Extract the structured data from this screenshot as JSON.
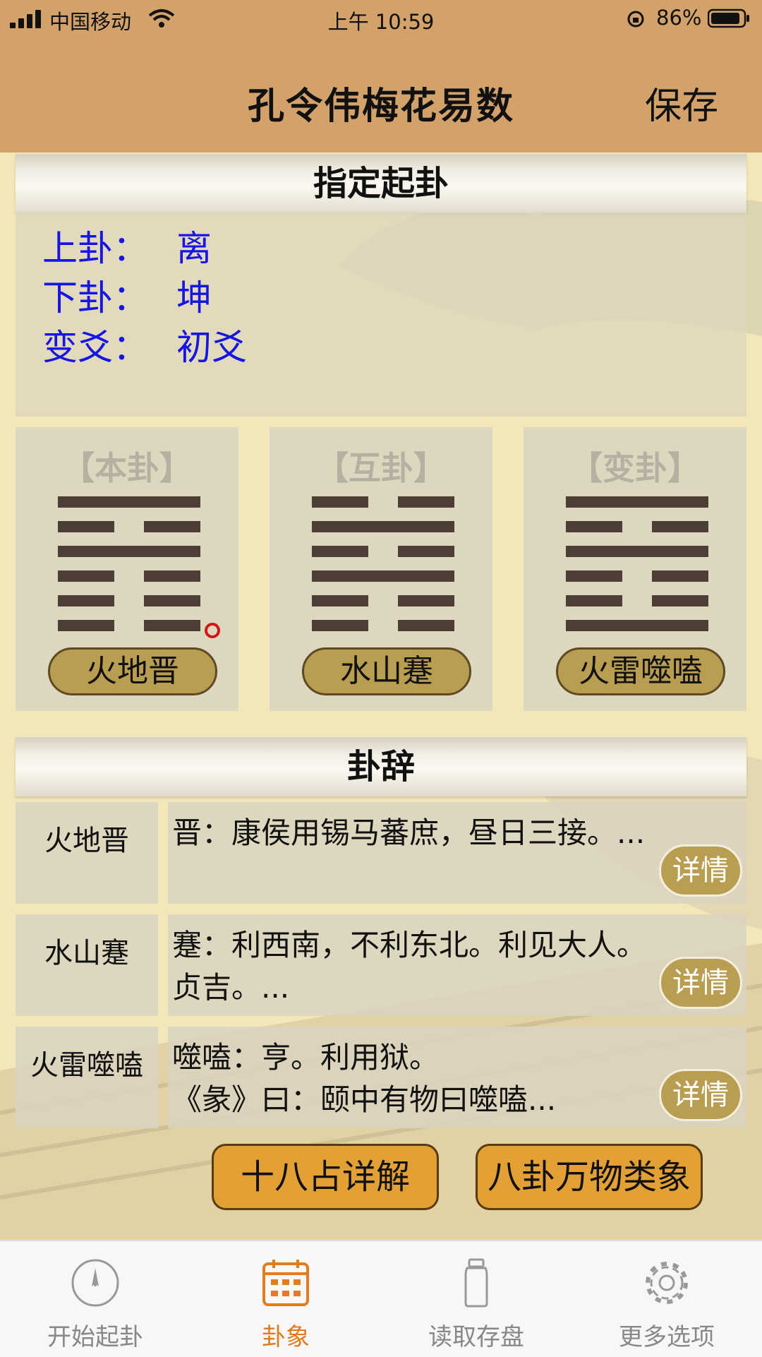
{
  "status_bar": {
    "carrier": "中国移动",
    "time": "上午 10:59",
    "battery": "86%"
  },
  "nav": {
    "title": "孔令伟梅花易数",
    "save_label": "保存"
  },
  "designation": {
    "header": "指定起卦",
    "rows": [
      {
        "label": "上卦：",
        "value": "离"
      },
      {
        "label": "下卦：",
        "value": "坤"
      },
      {
        "label": "变爻：",
        "value": "初爻"
      }
    ]
  },
  "hexagrams": [
    {
      "title": "【本卦】",
      "name": "火地晋",
      "lines_top_to_bottom": [
        "yang",
        "yin",
        "yang",
        "yin",
        "yin",
        "yin"
      ],
      "moving_line": 6
    },
    {
      "title": "【互卦】",
      "name": "水山蹇",
      "lines_top_to_bottom": [
        "yin",
        "yang",
        "yin",
        "yang",
        "yin",
        "yin"
      ],
      "moving_line": null
    },
    {
      "title": "【变卦】",
      "name": "火雷噬嗑",
      "lines_top_to_bottom": [
        "yang",
        "yin",
        "yang",
        "yin",
        "yin",
        "yang"
      ],
      "moving_line": null
    }
  ],
  "judgments": {
    "header": "卦辞",
    "detail_label": "详情",
    "rows": [
      {
        "name": "火地晋",
        "text": "晋：康侯用锡马蕃庶，昼日三接。..."
      },
      {
        "name": "水山蹇",
        "text": "蹇：利西南，不利东北。利见大人。贞吉。..."
      },
      {
        "name": "火雷噬嗑",
        "text": "噬嗑：亨。利用狱。\n《彖》曰：颐中有物曰噬嗑..."
      }
    ]
  },
  "actions": {
    "eighteen_label": "十八占详解",
    "bagua_label": "八卦万物类象"
  },
  "tabs": [
    {
      "label": "开始起卦",
      "icon": "compass-icon",
      "active": false
    },
    {
      "label": "卦象",
      "icon": "calendar-icon",
      "active": true
    },
    {
      "label": "读取存盘",
      "icon": "bottle-icon",
      "active": false
    },
    {
      "label": "更多选项",
      "icon": "gear-icon",
      "active": false
    }
  ],
  "colors": {
    "nav": "#d3a26a",
    "label_blue": "#1515e6",
    "accent_orange": "#e07b1e",
    "button_gold": "#b99e52"
  }
}
